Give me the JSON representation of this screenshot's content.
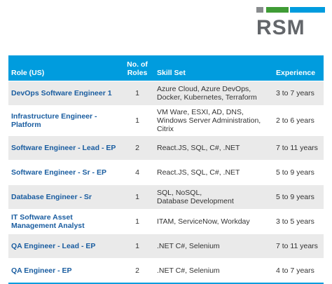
{
  "logo": {
    "text": "RSM",
    "bar_colors": [
      "#888b8d",
      "#3f9c35",
      "#009cde"
    ],
    "text_color": "#63666a"
  },
  "colors": {
    "header_bg": "#009cde",
    "role_text": "#1a5da0",
    "stripe_bg": "#eaeaea",
    "bottom_line": "#009cde"
  },
  "table": {
    "headers": {
      "role": "Role (US)",
      "num_roles": "No. of Roles",
      "skill_set": "Skill Set",
      "experience": "Experience"
    },
    "rows": [
      {
        "role": "DevOps Software Engineer 1",
        "num_roles": "1",
        "skills": [
          "Azure Cloud, Azure DevOps,",
          "Docker, Kubernetes, Terraform"
        ],
        "experience": "3 to 7 years"
      },
      {
        "role": "Infrastructure Engineer - Platform",
        "num_roles": "1",
        "skills": [
          "VM Ware, ESXI, AD, DNS,",
          "Windows Server Administration, Citrix"
        ],
        "experience": "2 to 6 years"
      },
      {
        "role": "Software Engineer - Lead - EP",
        "num_roles": "2",
        "skills": [
          "React.JS, SQL, C#, .NET"
        ],
        "experience": "7 to 11 years"
      },
      {
        "role": "Software Engineer - Sr - EP",
        "num_roles": "4",
        "skills": [
          "React.JS, SQL, C#, .NET"
        ],
        "experience": "5 to 9 years"
      },
      {
        "role": "Database Engineer - Sr",
        "num_roles": "1",
        "skills": [
          "SQL, NoSQL,",
          "Database Development"
        ],
        "experience": "5 to 9 years"
      },
      {
        "role": "IT Software Asset Management Analyst",
        "num_roles": "1",
        "skills": [
          "ITAM, ServiceNow, Workday"
        ],
        "experience": "3 to 5 years"
      },
      {
        "role": "QA Engineer - Lead - EP",
        "num_roles": "1",
        "skills": [
          ".NET C#, Selenium"
        ],
        "experience": "7 to 11 years"
      },
      {
        "role": "QA Engineer - EP",
        "num_roles": "2",
        "skills": [
          ".NET C#, Selenium"
        ],
        "experience": "4 to 7 years"
      }
    ]
  }
}
